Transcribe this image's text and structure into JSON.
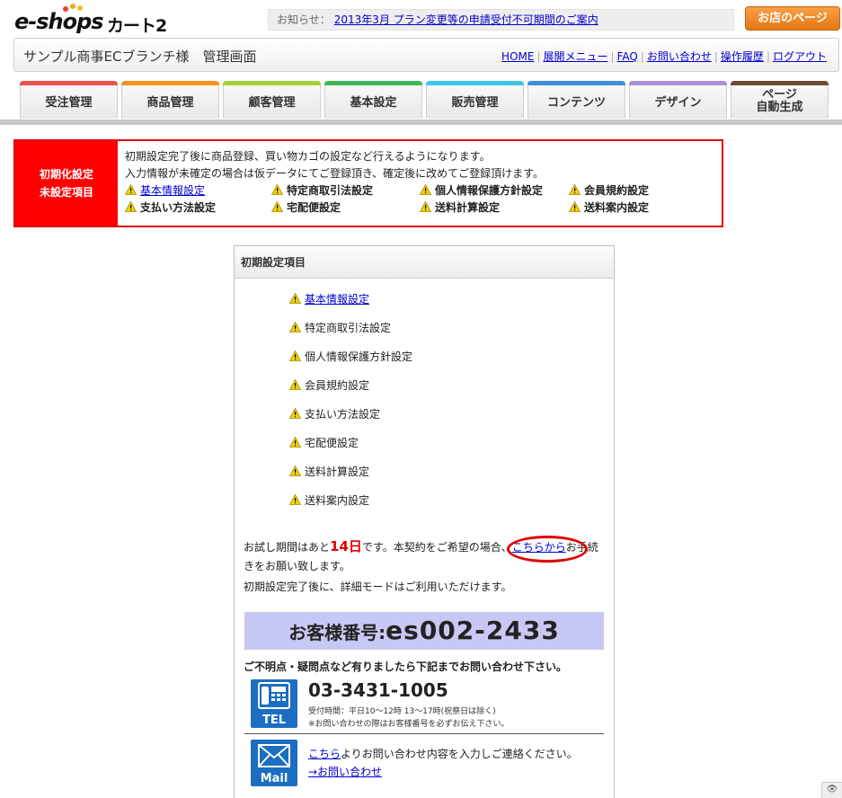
{
  "logo": {
    "part1": "e-shops",
    "part2": "カート2"
  },
  "news": {
    "label": "お知らせ：",
    "link": "2013年3月 プラン変更等の申請受付不可期間のご案内"
  },
  "shop_button": "お店のページ",
  "header": {
    "title": "サンプル商事ECブランチ様　管理画面",
    "links": [
      "HOME",
      "展開メニュー",
      "FAQ",
      "お問い合わせ",
      "操作履歴",
      "ログアウト"
    ]
  },
  "tabs": [
    {
      "label": "受注管理",
      "color": "#e8534c"
    },
    {
      "label": "商品管理",
      "color": "#f39321"
    },
    {
      "label": "顧客管理",
      "color": "#a9cf3a"
    },
    {
      "label": "基本設定",
      "color": "#3cb858"
    },
    {
      "label": "販売管理",
      "color": "#3fc4e6"
    },
    {
      "label": "コンテンツ",
      "color": "#3f8ed8"
    },
    {
      "label": "デザイン",
      "color": "#a98fd8"
    },
    {
      "label1": "ページ",
      "label2": "自動生成",
      "color": "#6e4a36"
    }
  ],
  "alert": {
    "head1": "初期化設定",
    "head2": "未設定項目",
    "line1": "初期設定完了後に商品登録、買い物カゴの設定など行えるようになります。",
    "line2": "入力情報が未確定の場合は仮データにてご登録頂き、確定後に改めてご登録頂けます。",
    "items": [
      "基本情報設定",
      "特定商取引法設定",
      "個人情報保護方針設定",
      "会員規約設定",
      "支払い方法設定",
      "宅配便設定",
      "送料計算設定",
      "送料案内設定"
    ]
  },
  "panel": {
    "title": "初期設定項目",
    "items": [
      "基本情報設定",
      "特定商取引法設定",
      "個人情報保護方針設定",
      "会員規約設定",
      "支払い方法設定",
      "宅配便設定",
      "送料計算設定",
      "送料案内設定"
    ],
    "trial_pre": "お試し期間はあと",
    "trial_days": "14日",
    "trial_mid": "です。本契約をご希望の場合、",
    "trial_link": "こちらから",
    "trial_post": "お手続きをお願い致します。",
    "after_setup": "初期設定完了後に、詳細モードはご利用いただけます。",
    "customer_label": "お客様番号:",
    "customer_number": "es002-2433",
    "contact_lead": "ご不明点・疑問点など有りましたら下記までお問い合わせ下さい。",
    "tel_label": "TEL",
    "tel_number": "03-3431-1005",
    "tel_hours": "受付時間：平日10～12時 13～17時(祝祭日は除く)",
    "tel_note": "※お問い合わせの際はお客様番号を必ずお伝え下さい。",
    "mail_label": "Mail",
    "mail_link": "こちら",
    "mail_text": "よりお問い合わせ内容を入力しご連絡ください。",
    "mail_link2": "→お問い合わせ"
  },
  "corner_icon": "eye-icon"
}
